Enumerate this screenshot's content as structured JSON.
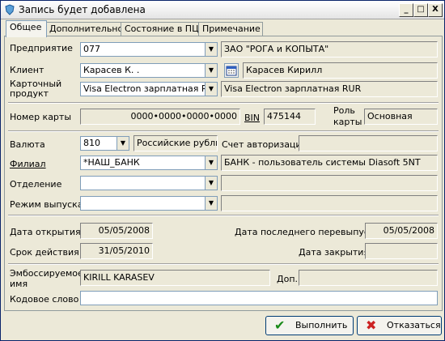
{
  "window": {
    "title": "Запись будет добавлена",
    "minimize": "_",
    "maximize": "□",
    "close": "X"
  },
  "tabs": [
    "Общее",
    "Дополнительно",
    "Состояние в ПЦ",
    "Примечание"
  ],
  "form": {
    "enterprise": {
      "label": "Предприятие",
      "code": "077",
      "name": "ЗАО \"РОГА и КОПЫТА\""
    },
    "client": {
      "label": "Клиент",
      "short": "Карасев К. .",
      "full": "Карасев Кирилл"
    },
    "card_product": {
      "label1": "Карточный",
      "label2": "продукт",
      "value": "Visa Electron зарплатная RU",
      "full": "Visa Electron зарплатная RUR"
    },
    "card_number": {
      "label": "Номер карты",
      "value": "0000•0000•0000•0000",
      "bin_label": "BIN",
      "bin": "475144",
      "role_label1": "Роль",
      "role_label2": "карты",
      "role": "Основная"
    },
    "currency": {
      "label": "Валюта",
      "code": "810",
      "name": "Российские рубли",
      "auth_account_label": "Счет авторизации",
      "auth_account": ""
    },
    "branch": {
      "label": "Филиал",
      "value": "*НАШ_БАНК",
      "full": "БАНК - пользователь системы Diasoft 5NT"
    },
    "department": {
      "label": "Отделение",
      "value": "",
      "full": ""
    },
    "issue_mode": {
      "label": "Режим выпуска",
      "value": "",
      "full": ""
    },
    "open_date": {
      "label": "Дата открытия",
      "value": "05/05/2008"
    },
    "last_reissue": {
      "label": "Дата последнего перевыпуска",
      "value": "05/05/2008"
    },
    "expiry": {
      "label": "Срок действия",
      "value": "31/05/2010"
    },
    "close_date": {
      "label": "Дата закрытия",
      "value": ""
    },
    "embossed": {
      "label1": "Эмбоссируемое",
      "label2": "имя",
      "value": "KIRILL KARASEV",
      "extra_label": "Доп.",
      "extra": ""
    },
    "codeword": {
      "label": "Кодовое слово",
      "value": ""
    }
  },
  "buttons": {
    "ok": "Выполнить",
    "cancel": "Отказаться"
  },
  "colors": {
    "ok_icon": "#1a8a1a",
    "cancel_icon": "#cc2222"
  }
}
